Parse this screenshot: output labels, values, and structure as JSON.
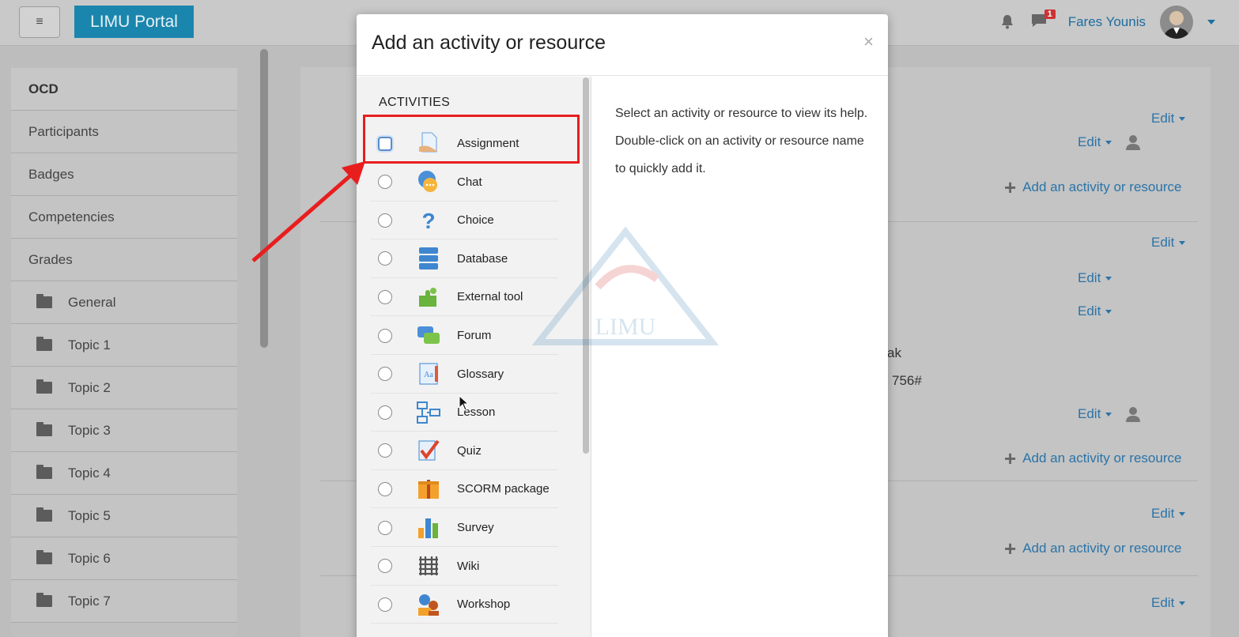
{
  "navbar": {
    "menu_icon": "hamburger-icon",
    "brand": "LIMU Portal",
    "message_count": "1",
    "username": "Fares Younis"
  },
  "leftnav": {
    "items": [
      {
        "label": "OCD",
        "type": "head"
      },
      {
        "label": "Participants",
        "type": "link"
      },
      {
        "label": "Badges",
        "type": "link"
      },
      {
        "label": "Competencies",
        "type": "link"
      },
      {
        "label": "Grades",
        "type": "link"
      },
      {
        "label": "General",
        "type": "folder"
      },
      {
        "label": "Topic 1",
        "type": "folder"
      },
      {
        "label": "Topic 2",
        "type": "folder"
      },
      {
        "label": "Topic 3",
        "type": "folder"
      },
      {
        "label": "Topic 4",
        "type": "folder"
      },
      {
        "label": "Topic 5",
        "type": "folder"
      },
      {
        "label": "Topic 6",
        "type": "folder"
      },
      {
        "label": "Topic 7",
        "type": "folder"
      }
    ]
  },
  "course": {
    "edit_label": "Edit",
    "add_label": "Add an activity or resource",
    "fragments": [
      "ak",
      "756#"
    ]
  },
  "modal": {
    "title": "Add an activity or resource",
    "close": "×",
    "section": "ACTIVITIES",
    "help_text": "Select an activity or resource to view its help. Double-click on an activity or resource name to quickly add it.",
    "watermark_text": "LIMU",
    "options": [
      {
        "label": "Assignment",
        "icon": "assignment-icon",
        "selected": true
      },
      {
        "label": "Chat",
        "icon": "chat-icon"
      },
      {
        "label": "Choice",
        "icon": "choice-icon"
      },
      {
        "label": "Database",
        "icon": "database-icon"
      },
      {
        "label": "External tool",
        "icon": "external-tool-icon"
      },
      {
        "label": "Forum",
        "icon": "forum-icon"
      },
      {
        "label": "Glossary",
        "icon": "glossary-icon"
      },
      {
        "label": "Lesson",
        "icon": "lesson-icon"
      },
      {
        "label": "Quiz",
        "icon": "quiz-icon"
      },
      {
        "label": "SCORM package",
        "icon": "scorm-icon"
      },
      {
        "label": "Survey",
        "icon": "survey-icon"
      },
      {
        "label": "Wiki",
        "icon": "wiki-icon"
      },
      {
        "label": "Workshop",
        "icon": "workshop-icon"
      }
    ]
  },
  "colors": {
    "accent": "#1b86ad",
    "link": "#2a74a8",
    "highlight": "#e81e1e"
  }
}
